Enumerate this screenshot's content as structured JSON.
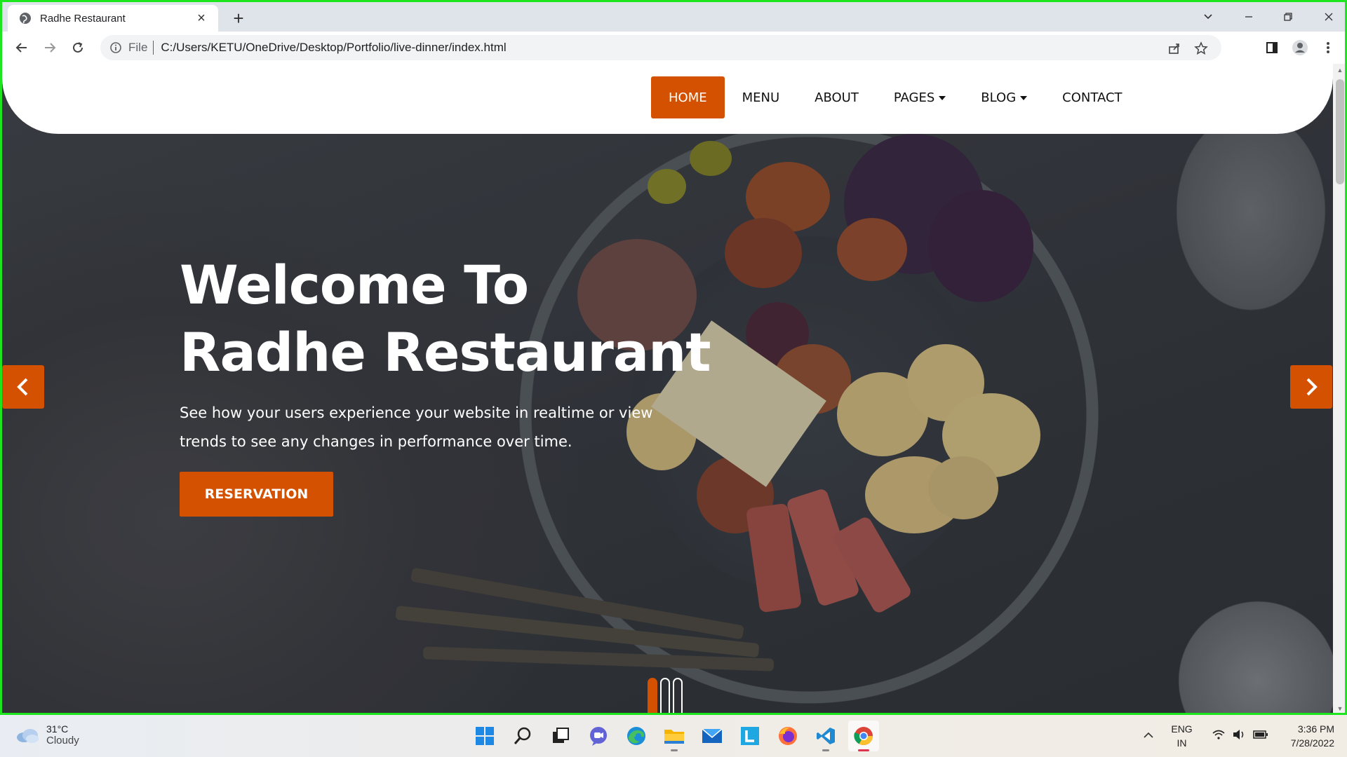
{
  "browser": {
    "tab_title": "Radhe Restaurant",
    "tab_close": "×",
    "new_tab": "+",
    "url_scheme": "File",
    "url": "C:/Users/KETU/OneDrive/Desktop/Portfolio/live-dinner/index.html"
  },
  "nav": {
    "items": [
      {
        "label": "HOME",
        "active": true,
        "dropdown": false
      },
      {
        "label": "MENU",
        "active": false,
        "dropdown": false
      },
      {
        "label": "ABOUT",
        "active": false,
        "dropdown": false
      },
      {
        "label": "PAGES",
        "active": false,
        "dropdown": true
      },
      {
        "label": "BLOG",
        "active": false,
        "dropdown": true
      },
      {
        "label": "CONTACT",
        "active": false,
        "dropdown": false
      }
    ]
  },
  "hero": {
    "title_line1": "Welcome To",
    "title_line2": "Radhe Restaurant",
    "subtitle_line1": "See how your users experience your website in realtime or view",
    "subtitle_line2": "trends to see any changes in performance over time.",
    "button_label": "RESERVATION",
    "slide_count": 3,
    "active_slide": 1
  },
  "colors": {
    "accent": "#d35100",
    "frame_border": "#1ee61e"
  },
  "taskbar": {
    "weather_temp": "31°C",
    "weather_condition": "Cloudy",
    "lang_line1": "ENG",
    "lang_line2": "IN",
    "time": "3:36 PM",
    "date": "7/28/2022",
    "apps": [
      "start-icon",
      "search-icon",
      "task-view-icon",
      "teams-chat-icon",
      "edge-icon",
      "file-explorer-icon",
      "mail-icon",
      "l-app-icon",
      "firefox-icon",
      "vscode-icon",
      "chrome-icon"
    ]
  }
}
